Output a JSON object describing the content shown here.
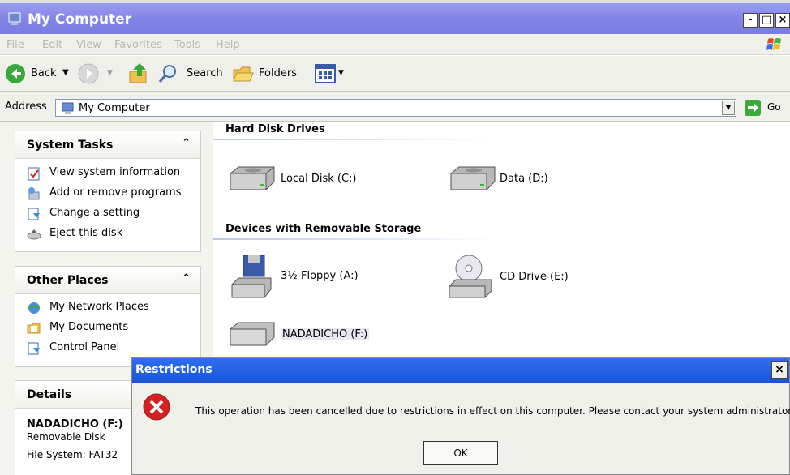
{
  "window": {
    "title": "My Computer"
  },
  "menu": [
    "File",
    "Edit",
    "View",
    "Favorites",
    "Tools",
    "Help"
  ],
  "toolbar": {
    "back": "Back",
    "search": "Search",
    "folders": "Folders"
  },
  "address": {
    "label": "Address",
    "value": "My Computer",
    "go": "Go"
  },
  "sidebar": {
    "system_tasks": {
      "title": "System Tasks",
      "items": [
        "View system information",
        "Add or remove programs",
        "Change a setting",
        "Eject this disk"
      ]
    },
    "other_places": {
      "title": "Other Places",
      "items": [
        "My Network Places",
        "My Documents",
        "Control Panel"
      ]
    },
    "details": {
      "title": "Details",
      "name": "NADADICHO (F:)",
      "type": "Removable Disk",
      "fs": "File System: FAT32"
    }
  },
  "main": {
    "hdd_title": "Hard Disk Drives",
    "hdd": [
      "Local Disk (C:)",
      "Data (D:)"
    ],
    "removable_title": "Devices with Removable Storage",
    "removable": [
      "3½ Floppy (A:)",
      "CD Drive (E:)",
      "NADADICHO (F:)"
    ]
  },
  "dialog": {
    "title": "Restrictions",
    "message": "This operation has been cancelled due to restrictions in effect on this computer. Please contact your system administrator.",
    "ok": "OK"
  },
  "colors": {
    "title_bar": "#8183e6",
    "dialog_title": "#1a55d8",
    "error": "#d42020"
  }
}
